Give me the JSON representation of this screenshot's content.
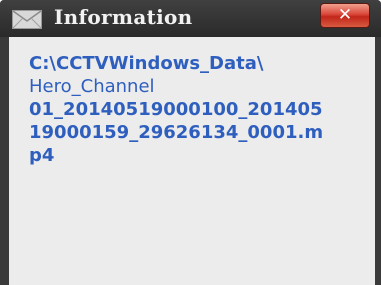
{
  "window": {
    "title": "Information",
    "close_label": "✕",
    "title_icon": "envelope-icon"
  },
  "message": {
    "lines": [
      "C:\\CCTVWindows_Data\\",
      "Hero_Channel",
      "01_20140519000100_201405",
      "19000159_29626134_0001.m",
      "p4"
    ]
  },
  "colors": {
    "message_text": "#2f5fbe",
    "titlebar": "#333333",
    "content_background": "#ececec",
    "close_button": "#d0392b"
  }
}
